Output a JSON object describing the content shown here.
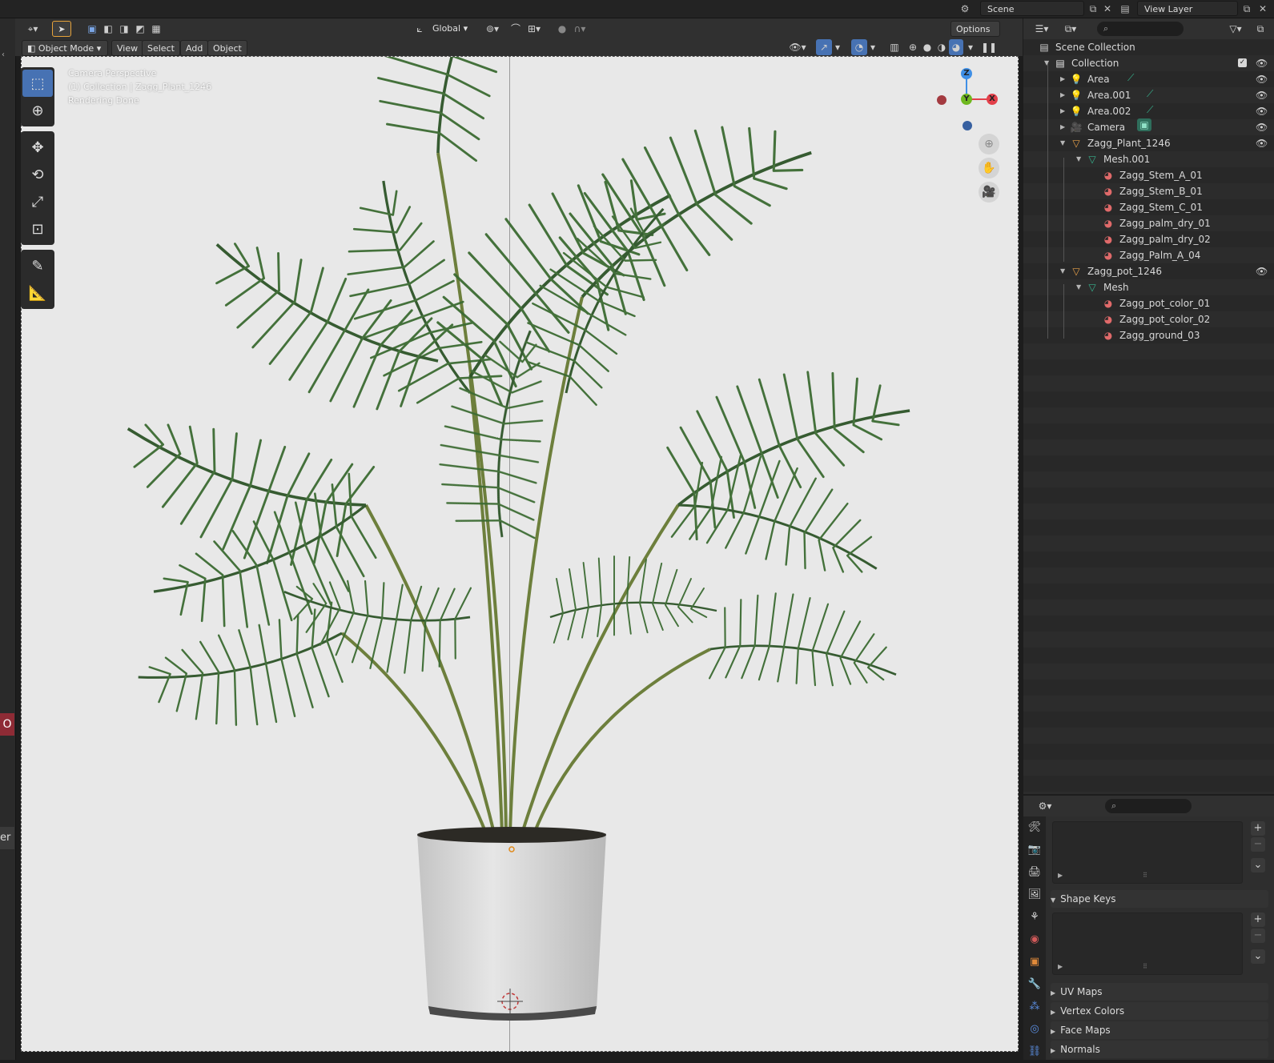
{
  "top_bar": {
    "scene_label": "Scene",
    "view_layer_label": "View Layer"
  },
  "viewport_header": {
    "mode": "Object Mode",
    "menus": [
      "View",
      "Select",
      "Add",
      "Object"
    ],
    "transform_orientation": "Global",
    "options_label": "Options"
  },
  "viewport": {
    "overlay_lines": [
      "Camera Perspective",
      "(1) Collection | Zagg_Plant_1246",
      "Rendering Done"
    ],
    "gizmo": {
      "z": "Z",
      "y": "Y",
      "x": "X"
    },
    "colors": {
      "background": "#e8e8e8",
      "x_axis": "#e3404a",
      "y_axis": "#6fb81f",
      "z_axis": "#3f8fe6",
      "leaf": "#2e5a2a",
      "pot": "#d9d9d9"
    }
  },
  "toolbar": {
    "tools": [
      "select-box-icon",
      "cursor-icon",
      "move-icon",
      "rotate-icon",
      "scale-icon",
      "transform-icon",
      "annotate-icon",
      "measure-icon"
    ]
  },
  "outliner": {
    "search_placeholder": "",
    "rows": [
      {
        "label": "Scene Collection",
        "icon": "scene-collection-icon",
        "depth": 0,
        "expander": "",
        "eye": false
      },
      {
        "label": "Collection",
        "icon": "collection-icon",
        "depth": 1,
        "expander": "▼",
        "eye": true
      },
      {
        "label": "Area",
        "icon": "light-icon",
        "depth": 2,
        "expander": "▶",
        "eye": true
      },
      {
        "label": "Area.001",
        "icon": "light-icon",
        "depth": 2,
        "expander": "▶",
        "eye": true
      },
      {
        "label": "Area.002",
        "icon": "light-icon",
        "depth": 2,
        "expander": "▶",
        "eye": true
      },
      {
        "label": "Camera",
        "icon": "camera-icon",
        "depth": 2,
        "expander": "▶",
        "eye": true
      },
      {
        "label": "Zagg_Plant_1246",
        "icon": "mesh-object-icon",
        "depth": 2,
        "expander": "▼",
        "eye": true
      },
      {
        "label": "Mesh.001",
        "icon": "mesh-data-icon",
        "depth": 3,
        "expander": "▼",
        "eye": false
      },
      {
        "label": "Zagg_Stem_A_01",
        "icon": "material-icon",
        "depth": 4,
        "expander": "",
        "eye": false
      },
      {
        "label": "Zagg_Stem_B_01",
        "icon": "material-icon",
        "depth": 4,
        "expander": "",
        "eye": false
      },
      {
        "label": "Zagg_Stem_C_01",
        "icon": "material-icon",
        "depth": 4,
        "expander": "",
        "eye": false
      },
      {
        "label": "Zagg_palm_dry_01",
        "icon": "material-icon",
        "depth": 4,
        "expander": "",
        "eye": false
      },
      {
        "label": "Zagg_palm_dry_02",
        "icon": "material-icon",
        "depth": 4,
        "expander": "",
        "eye": false
      },
      {
        "label": "Zagg_Palm_A_04",
        "icon": "material-icon",
        "depth": 4,
        "expander": "",
        "eye": false
      },
      {
        "label": "Zagg_pot_1246",
        "icon": "mesh-object-icon",
        "depth": 2,
        "expander": "▼",
        "eye": true
      },
      {
        "label": "Mesh",
        "icon": "mesh-data-icon",
        "depth": 3,
        "expander": "▼",
        "eye": false
      },
      {
        "label": "Zagg_pot_color_01",
        "icon": "material-icon",
        "depth": 4,
        "expander": "",
        "eye": false
      },
      {
        "label": "Zagg_pot_color_02",
        "icon": "material-icon",
        "depth": 4,
        "expander": "",
        "eye": false
      },
      {
        "label": "Zagg_ground_03",
        "icon": "material-icon",
        "depth": 4,
        "expander": "",
        "eye": false
      }
    ]
  },
  "properties": {
    "panels": [
      "Shape Keys",
      "UV Maps",
      "Vertex Colors",
      "Face Maps",
      "Normals"
    ],
    "tabs": [
      "tool-icon",
      "render-icon",
      "output-icon",
      "view-layer-icon",
      "scene-icon",
      "world-icon",
      "object-icon",
      "modifier-icon",
      "particles-icon",
      "physics-icon",
      "constraints-icon"
    ]
  },
  "left_edge": {
    "fragments": [
      "O",
      "er"
    ]
  }
}
